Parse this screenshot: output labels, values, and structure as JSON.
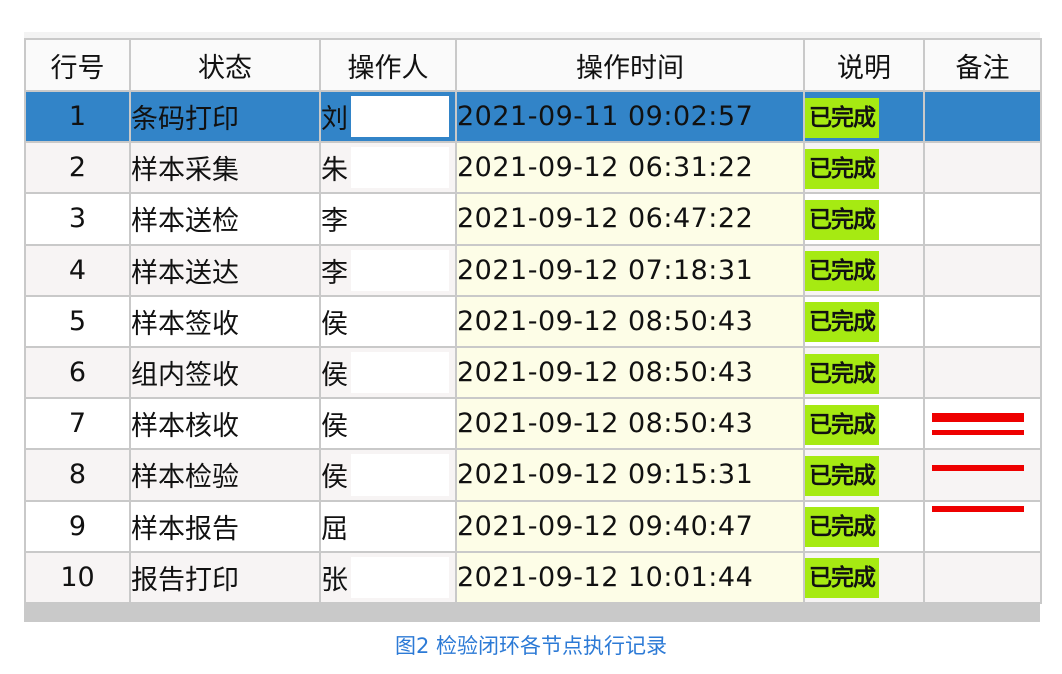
{
  "columns": [
    "行号",
    "状态",
    "操作人",
    "操作时间",
    "说明",
    "备注"
  ],
  "rows": [
    {
      "num": "1",
      "status": "条码打印",
      "operator": "刘",
      "time": "2021-09-11 09:02:57",
      "desc": "已完成",
      "note": "",
      "selected": true
    },
    {
      "num": "2",
      "status": "样本采集",
      "operator": "朱",
      "time": "2021-09-12 06:31:22",
      "desc": "已完成",
      "note": ""
    },
    {
      "num": "3",
      "status": "样本送检",
      "operator": "李",
      "time": "2021-09-12 06:47:22",
      "desc": "已完成",
      "note": ""
    },
    {
      "num": "4",
      "status": "样本送达",
      "operator": "李",
      "time": "2021-09-12 07:18:31",
      "desc": "已完成",
      "note": ""
    },
    {
      "num": "5",
      "status": "样本签收",
      "operator": "侯",
      "time": "2021-09-12 08:50:43",
      "desc": "已完成",
      "note": ""
    },
    {
      "num": "6",
      "status": "组内签收",
      "operator": "侯",
      "time": "2021-09-12 08:50:43",
      "desc": "已完成",
      "note": ""
    },
    {
      "num": "7",
      "status": "样本核收",
      "operator": "侯",
      "time": "2021-09-12 08:50:43",
      "desc": "已完成",
      "note": ""
    },
    {
      "num": "8",
      "status": "样本检验",
      "operator": "侯",
      "time": "2021-09-12 09:15:31",
      "desc": "已完成",
      "note": ""
    },
    {
      "num": "9",
      "status": "样本报告",
      "operator": "屈",
      "time": "2021-09-12 09:40:47",
      "desc": "已完成",
      "note": ""
    },
    {
      "num": "10",
      "status": "报告打印",
      "operator": "张",
      "time": "2021-09-12 10:01:44",
      "desc": "已完成",
      "note": ""
    }
  ],
  "caption": "图2 检验闭环各节点执行记录",
  "colors": {
    "selected_row": "#3284c8",
    "badge": "#a6ea12",
    "time_cell": "#fdfde7",
    "redaction": "#ee0000",
    "caption": "#2c7ad6"
  }
}
